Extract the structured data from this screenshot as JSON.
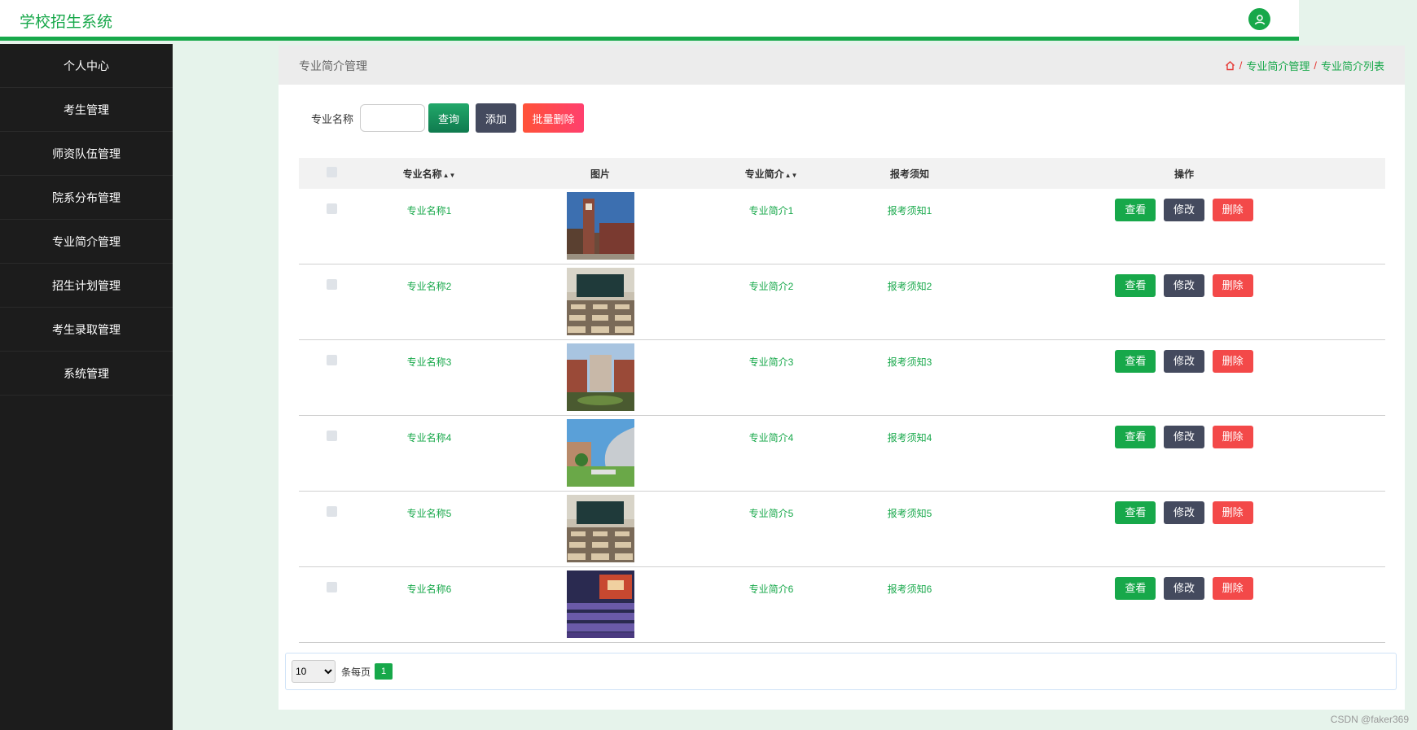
{
  "app": {
    "title": "学校招生系统"
  },
  "sidebar": {
    "items": [
      {
        "label": "个人中心"
      },
      {
        "label": "考生管理"
      },
      {
        "label": "师资队伍管理"
      },
      {
        "label": "院系分布管理"
      },
      {
        "label": "专业简介管理"
      },
      {
        "label": "招生计划管理"
      },
      {
        "label": "考生录取管理"
      },
      {
        "label": "系统管理"
      }
    ]
  },
  "page": {
    "title": "专业简介管理"
  },
  "breadcrumb": {
    "items": [
      "专业简介管理",
      "专业简介列表"
    ],
    "separator": "/"
  },
  "search": {
    "label": "专业名称",
    "value": "",
    "placeholder": "",
    "query_label": "查询",
    "add_label": "添加",
    "batch_delete_label": "批量删除"
  },
  "table": {
    "headers": {
      "name": "专业名称",
      "image": "图片",
      "intro": "专业简介",
      "notice": "报考须知",
      "ops": "操作"
    },
    "ops": {
      "view": "查看",
      "edit": "修改",
      "delete": "删除"
    },
    "rows": [
      {
        "name": "专业名称1",
        "intro": "专业简介1",
        "notice": "报考须知1",
        "image": "clock-tower-building-photo"
      },
      {
        "name": "专业名称2",
        "intro": "专业简介2",
        "notice": "报考须知2",
        "image": "classroom-photo"
      },
      {
        "name": "专业名称3",
        "intro": "专业简介3",
        "notice": "报考须知3",
        "image": "campus-courtyard-photo"
      },
      {
        "name": "专业名称4",
        "intro": "专业简介4",
        "notice": "报考须知4",
        "image": "curved-building-photo"
      },
      {
        "name": "专业名称5",
        "intro": "专业简介5",
        "notice": "报考须知5",
        "image": "classroom-photo"
      },
      {
        "name": "专业名称6",
        "intro": "专业简介6",
        "notice": "报考须知6",
        "image": "auditorium-photo"
      }
    ]
  },
  "pagination": {
    "page_size": "10",
    "page_size_options": [
      "10"
    ],
    "per_page_label": "条每页",
    "current_page": "1"
  },
  "watermark": "CSDN @faker369",
  "colors": {
    "accent": "#17a84a",
    "danger": "#f34949",
    "dark": "#444a5e",
    "sidebar": "#1c1c1c"
  }
}
